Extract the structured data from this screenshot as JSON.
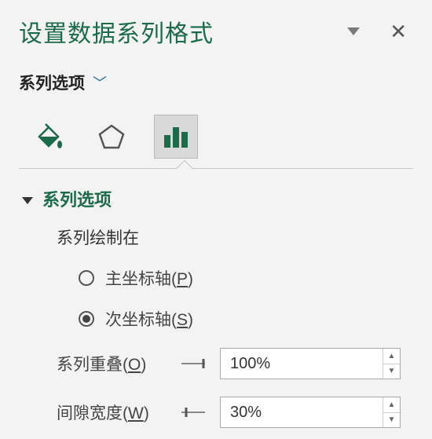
{
  "header": {
    "title": "设置数据系列格式"
  },
  "series_dropdown": {
    "label": "系列选项"
  },
  "tabs": {
    "fill": "fill-bucket",
    "effects": "pentagon-effects",
    "series": "bar-chart",
    "active": "series"
  },
  "section": {
    "title": "系列选项",
    "plot_on_label": "系列绘制在",
    "radios": {
      "primary": {
        "label_pre": "主坐标轴(",
        "key": "P",
        "label_post": ")"
      },
      "secondary": {
        "label_pre": "次坐标轴(",
        "key": "S",
        "label_post": ")"
      },
      "selected": "secondary"
    },
    "overlap": {
      "label_pre": "系列重叠(",
      "key": "O",
      "label_post": ")",
      "value": "100%"
    },
    "gap": {
      "label_pre": "间隙宽度(",
      "key": "W",
      "label_post": ")",
      "value": "30%"
    }
  }
}
